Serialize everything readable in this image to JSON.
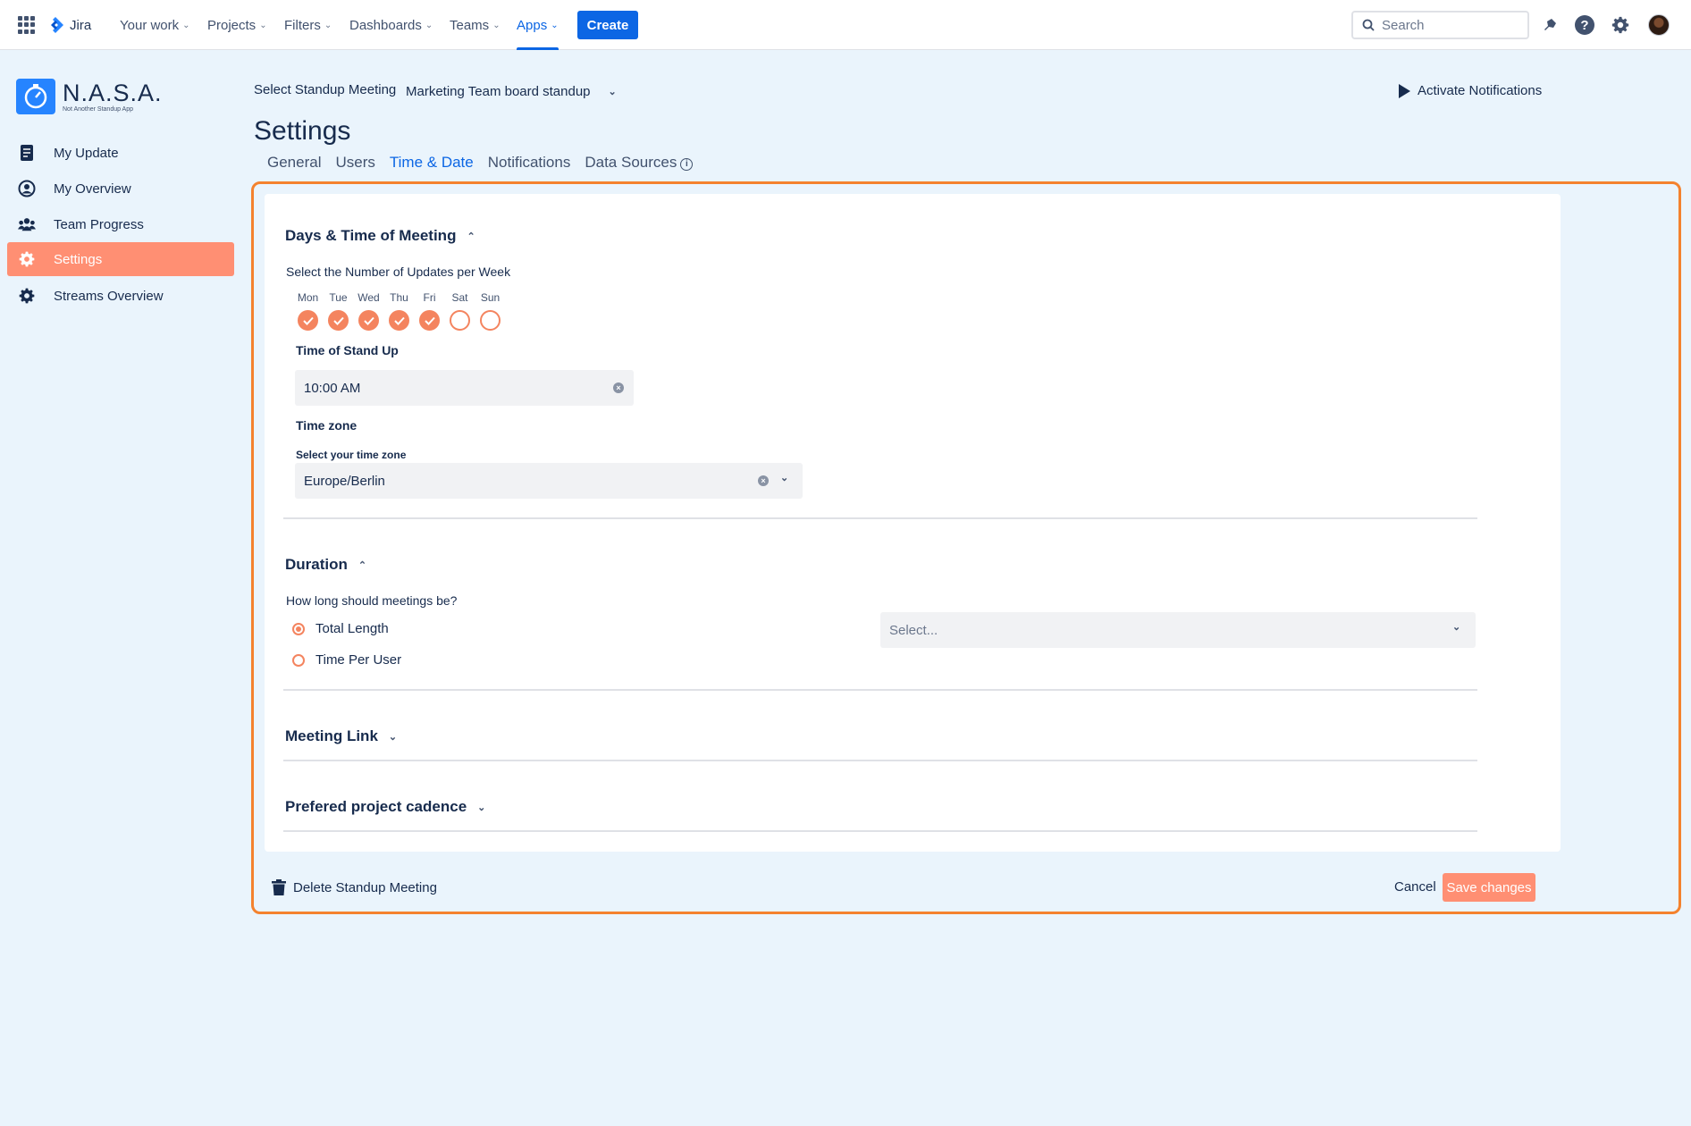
{
  "nav": {
    "app_name": "Jira",
    "items": [
      "Your work",
      "Projects",
      "Filters",
      "Dashboards",
      "Teams",
      "Apps"
    ],
    "create_label": "Create",
    "search_placeholder": "Search"
  },
  "brand": {
    "name": "N.A.S.A.",
    "subtitle": "Not Another Standup App"
  },
  "sidebar": {
    "items": [
      {
        "label": "My Update",
        "icon": "document-icon"
      },
      {
        "label": "My Overview",
        "icon": "user-circle-icon"
      },
      {
        "label": "Team Progress",
        "icon": "people-icon"
      },
      {
        "label": "Settings",
        "icon": "gear-icon",
        "active": true
      },
      {
        "label": "Streams Overview",
        "icon": "gear-icon"
      }
    ]
  },
  "header": {
    "select_meeting_label": "Select Standup Meeting",
    "selected_meeting": "Marketing Team board standup",
    "activate_label": "Activate Notifications",
    "title": "Settings",
    "tabs": [
      "General",
      "Users",
      "Time & Date",
      "Notifications",
      "Data Sources"
    ],
    "active_tab": "Time & Date"
  },
  "days_section": {
    "title": "Days & Time of Meeting",
    "updates_label": "Select the Number of Updates per Week",
    "days": [
      {
        "name": "Mon",
        "checked": true
      },
      {
        "name": "Tue",
        "checked": true
      },
      {
        "name": "Wed",
        "checked": true
      },
      {
        "name": "Thu",
        "checked": true
      },
      {
        "name": "Fri",
        "checked": true
      },
      {
        "name": "Sat",
        "checked": false
      },
      {
        "name": "Sun",
        "checked": false
      }
    ],
    "time_label": "Time of Stand Up",
    "time_value": "10:00 AM",
    "timezone_heading": "Time zone",
    "timezone_label": "Select your time zone",
    "timezone_value": "Europe/Berlin"
  },
  "duration_section": {
    "title": "Duration",
    "question": "How long should meetings be?",
    "options": [
      {
        "label": "Total Length",
        "selected": true
      },
      {
        "label": "Time Per User",
        "selected": false
      }
    ],
    "select_placeholder": "Select..."
  },
  "meeting_link_section": {
    "title": "Meeting Link"
  },
  "cadence_section": {
    "title": "Prefered project cadence"
  },
  "footer": {
    "delete_label": "Delete Standup Meeting",
    "cancel_label": "Cancel",
    "save_label": "Save changes"
  },
  "colors": {
    "accent": "#ff8f73",
    "day_check": "#f4845f",
    "primary_blue": "#0c66e4",
    "highlight_frame": "#f4822e",
    "background": "#eaf4fc"
  }
}
